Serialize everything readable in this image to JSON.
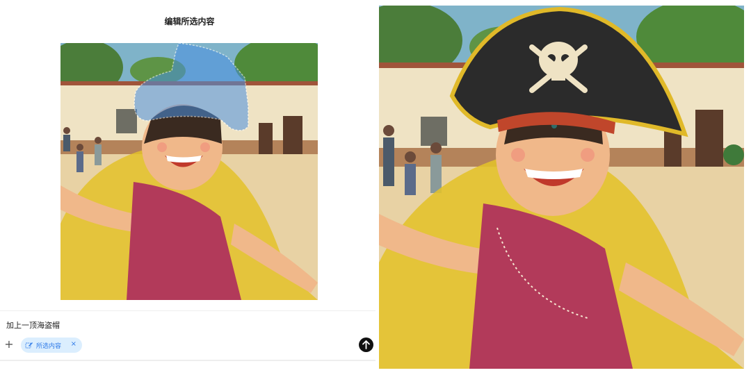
{
  "editor": {
    "title": "编辑所选内容",
    "prompt_text": "加上一顶海盗帽",
    "chip_label": "所选内容",
    "plus_symbol": "+",
    "close_symbol": "×",
    "icons": {
      "chip": "selection-edit-icon",
      "send": "arrow-up-icon"
    }
  },
  "colors": {
    "chip_bg": "#dbeefe",
    "chip_text": "#2f7be8",
    "selection_mask": "#4a90e2",
    "send_button": "#111111"
  }
}
